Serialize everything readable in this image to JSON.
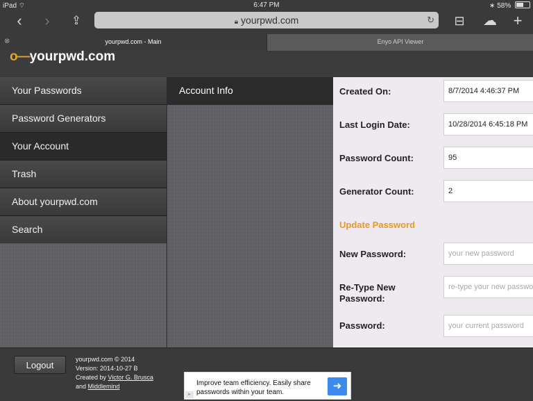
{
  "status_bar": {
    "device": "iPad",
    "time": "6:47 PM",
    "battery": "58%"
  },
  "browser": {
    "url": "yourpwd.com",
    "tabs": [
      {
        "title": "yourpwd.com - Main"
      },
      {
        "title": "Enyo API Viewer"
      }
    ]
  },
  "app": {
    "logo_text": "yourpwd.com",
    "logo_key": "o—"
  },
  "nav": {
    "items": [
      {
        "label": "Your Passwords"
      },
      {
        "label": "Password Generators"
      },
      {
        "label": "Your Account"
      },
      {
        "label": "Trash"
      },
      {
        "label": "About yourpwd.com"
      },
      {
        "label": "Search"
      }
    ]
  },
  "middle": {
    "header": "Account Info"
  },
  "account": {
    "created_on_label": "Created On:",
    "created_on": "8/7/2014 4:46:37 PM",
    "last_login_label": "Last Login Date:",
    "last_login": "10/28/2014 6:45:18 PM",
    "password_count_label": "Password Count:",
    "password_count": "95",
    "generator_count_label": "Generator Count:",
    "generator_count": "2",
    "update_link": "Update Password",
    "new_password_label": "New Password:",
    "new_password_placeholder": "your new password",
    "retype_label": "Re-Type New Password:",
    "retype_placeholder": "re-type your new password",
    "password_label": "Password:",
    "password_placeholder": "your current password"
  },
  "footer": {
    "logout_label": "Logout",
    "copyright": "yourpwd.com © 2014",
    "version": "Version: 2014-10-27 B",
    "created_by_prefix": "Created by ",
    "author": "Victor G. Brusca",
    "and_prefix": "and ",
    "company": "Middlemind"
  },
  "ad": {
    "text": "Improve team efficiency. Easily share passwords within your team.",
    "arrow": "➜"
  },
  "colors": {
    "accent": "#e8981e",
    "logo_key": "#e8a328",
    "panel_bg": "#efeaf0"
  }
}
